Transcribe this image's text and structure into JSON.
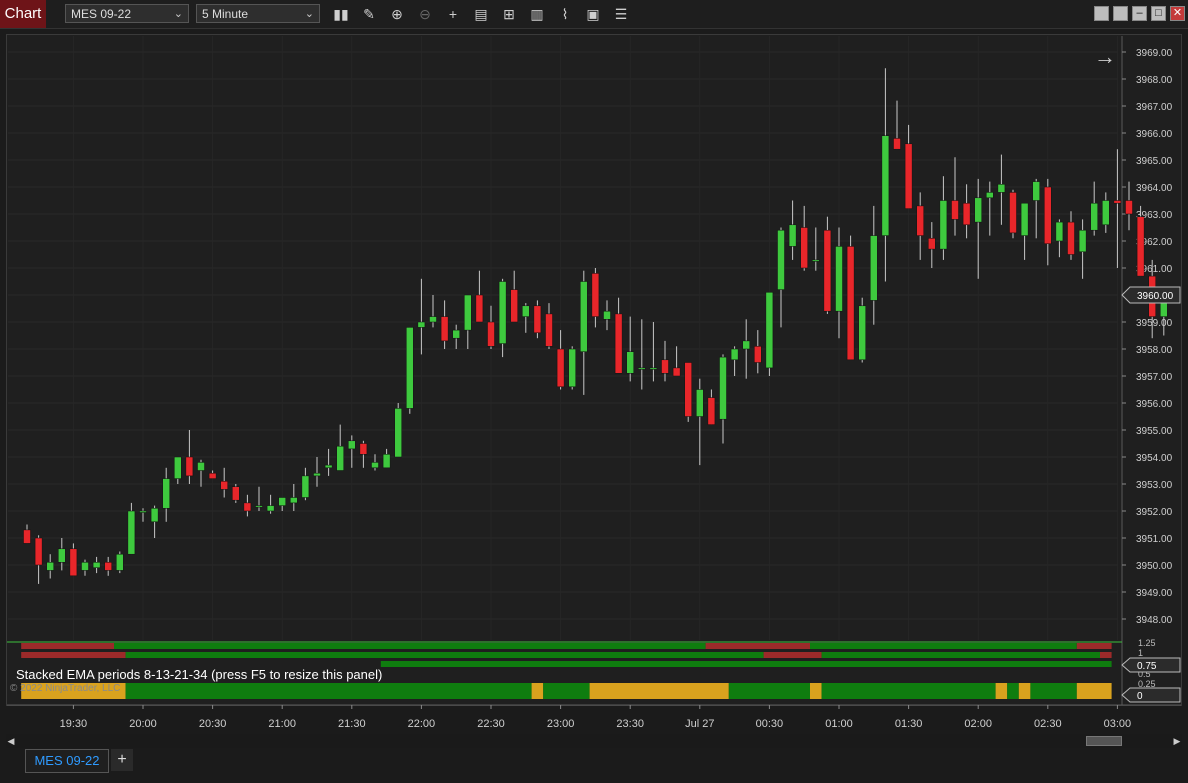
{
  "app": {
    "title": "Chart"
  },
  "toolbar": {
    "instrument": "MES 09-22",
    "interval": "5 Minute",
    "icons": [
      "bars-type-icon",
      "pencil-draw-icon",
      "zoom-in-icon",
      "zoom-out-icon",
      "crosshair-icon",
      "data-box-icon",
      "templates-icon",
      "strategies-icon",
      "indicators-icon",
      "properties-icon",
      "list-icon"
    ]
  },
  "window_controls": [
    "restore-icon",
    "restore-icon",
    "minimize-icon",
    "maximize-icon",
    "close-icon"
  ],
  "price_axis": {
    "labels": [
      "3969.00",
      "3968.00",
      "3967.00",
      "3966.00",
      "3965.00",
      "3964.00",
      "3963.00",
      "3962.00",
      "3961.00",
      "3960.00",
      "3959.00",
      "3958.00",
      "3957.00",
      "3956.00",
      "3955.00",
      "3954.00",
      "3953.00",
      "3952.00",
      "3951.00",
      "3950.00",
      "3949.00",
      "3948.00"
    ],
    "current_price": "3960.00"
  },
  "indicator_axis": {
    "labels": [
      "1.25",
      "1",
      "0.75",
      "0.5",
      "0.25",
      "0"
    ],
    "current_value": "0.75",
    "zero_label": "0"
  },
  "time_axis": {
    "labels": [
      "19:30",
      "20:00",
      "20:30",
      "21:00",
      "21:30",
      "22:00",
      "22:30",
      "23:00",
      "23:30",
      "Jul 27",
      "00:30",
      "01:00",
      "01:30",
      "02:00",
      "02:30",
      "03:00"
    ]
  },
  "indicator_panel": {
    "title": "Stacked EMA periods 8-13-21-34 (press F5 to resize this panel)"
  },
  "copyright": "© 2022 NinjaTrader, LLC",
  "tabs": [
    {
      "label": "MES 09-22"
    }
  ],
  "add_tab_label": "+",
  "colors": {
    "up": "#3ec93e",
    "down": "#e8262a",
    "gold": "#d9a21e",
    "green_bar": "#0f7d0f",
    "red_bar": "#9c2a2a",
    "background": "#1f1f1f"
  },
  "chart_data": {
    "type": "candlestick",
    "instrument": "MES 09-22",
    "interval": "5 Minute",
    "ylim": [
      3947.5,
      3969.5
    ],
    "candles": [
      [
        3951.3,
        3951.5,
        3950.8,
        3950.8
      ],
      [
        3951.0,
        3951.1,
        3949.3,
        3950.0
      ],
      [
        3949.8,
        3950.4,
        3949.5,
        3950.1
      ],
      [
        3950.1,
        3951.0,
        3949.8,
        3950.6
      ],
      [
        3950.6,
        3950.8,
        3949.6,
        3949.6
      ],
      [
        3949.8,
        3950.2,
        3949.6,
        3950.1
      ],
      [
        3949.9,
        3950.3,
        3949.7,
        3950.1
      ],
      [
        3950.1,
        3950.3,
        3949.6,
        3949.8
      ],
      [
        3949.8,
        3950.5,
        3949.7,
        3950.4
      ],
      [
        3950.4,
        3952.3,
        3950.4,
        3952.0
      ],
      [
        3952.0,
        3952.1,
        3951.6,
        3952.0
      ],
      [
        3951.6,
        3952.2,
        3951.0,
        3952.1
      ],
      [
        3952.1,
        3953.6,
        3951.6,
        3953.2
      ],
      [
        3953.2,
        3954.0,
        3953.0,
        3954.0
      ],
      [
        3954.0,
        3955.0,
        3953.0,
        3953.3
      ],
      [
        3953.5,
        3953.9,
        3952.9,
        3953.8
      ],
      [
        3953.4,
        3953.5,
        3953.2,
        3953.2
      ],
      [
        3953.1,
        3953.6,
        3952.5,
        3952.8
      ],
      [
        3952.9,
        3953.0,
        3952.3,
        3952.4
      ],
      [
        3952.3,
        3952.6,
        3951.8,
        3952.0
      ],
      [
        3952.2,
        3952.9,
        3952.0,
        3952.2
      ],
      [
        3952.0,
        3952.6,
        3951.9,
        3952.2
      ],
      [
        3952.2,
        3952.5,
        3952.0,
        3952.5
      ],
      [
        3952.3,
        3953.0,
        3952.0,
        3952.5
      ],
      [
        3952.5,
        3953.6,
        3952.4,
        3953.3
      ],
      [
        3953.3,
        3954.0,
        3952.9,
        3953.4
      ],
      [
        3953.6,
        3954.3,
        3953.3,
        3953.7
      ],
      [
        3953.5,
        3955.2,
        3953.5,
        3954.4
      ],
      [
        3954.3,
        3954.8,
        3953.6,
        3954.6
      ],
      [
        3954.5,
        3954.6,
        3953.6,
        3954.1
      ],
      [
        3953.6,
        3954.1,
        3953.5,
        3953.8
      ],
      [
        3953.6,
        3954.3,
        3953.6,
        3954.1
      ],
      [
        3954.0,
        3956.0,
        3954.0,
        3955.8
      ],
      [
        3955.8,
        3958.8,
        3955.6,
        3958.8
      ],
      [
        3958.8,
        3960.6,
        3957.8,
        3959.0
      ],
      [
        3959.0,
        3960.0,
        3958.8,
        3959.2
      ],
      [
        3959.2,
        3959.8,
        3958.0,
        3958.3
      ],
      [
        3958.4,
        3958.9,
        3958.0,
        3958.7
      ],
      [
        3958.7,
        3960.0,
        3958.0,
        3960.0
      ],
      [
        3960.0,
        3960.9,
        3959.3,
        3959.0
      ],
      [
        3959.0,
        3959.6,
        3958.0,
        3958.1
      ],
      [
        3958.2,
        3960.6,
        3957.7,
        3960.5
      ],
      [
        3960.2,
        3960.9,
        3959.0,
        3959.0
      ],
      [
        3959.2,
        3959.7,
        3958.6,
        3959.6
      ],
      [
        3959.6,
        3959.8,
        3958.4,
        3958.6
      ],
      [
        3959.3,
        3959.7,
        3958.0,
        3958.1
      ],
      [
        3958.0,
        3958.7,
        3956.5,
        3956.6
      ],
      [
        3956.6,
        3958.1,
        3956.5,
        3958.0
      ],
      [
        3957.9,
        3960.9,
        3956.3,
        3960.5
      ],
      [
        3960.8,
        3961.0,
        3958.8,
        3959.2
      ],
      [
        3959.1,
        3959.8,
        3958.7,
        3959.4
      ],
      [
        3959.3,
        3959.9,
        3957.6,
        3957.1
      ],
      [
        3957.1,
        3959.2,
        3956.8,
        3957.9
      ],
      [
        3957.3,
        3959.1,
        3956.5,
        3957.3
      ],
      [
        3957.3,
        3959.0,
        3956.8,
        3957.3
      ],
      [
        3957.6,
        3958.3,
        3956.8,
        3957.1
      ],
      [
        3957.3,
        3958.1,
        3957.0,
        3957.0
      ],
      [
        3957.5,
        3957.5,
        3955.3,
        3955.5
      ],
      [
        3955.5,
        3956.9,
        3953.7,
        3956.5
      ],
      [
        3956.2,
        3956.5,
        3955.2,
        3955.2
      ],
      [
        3955.4,
        3957.8,
        3954.5,
        3957.7
      ],
      [
        3957.6,
        3958.1,
        3957.0,
        3958.0
      ],
      [
        3958.0,
        3959.1,
        3956.9,
        3958.3
      ],
      [
        3958.1,
        3958.7,
        3957.1,
        3957.5
      ],
      [
        3957.3,
        3960.1,
        3957.0,
        3960.1
      ],
      [
        3960.2,
        3962.5,
        3958.8,
        3962.4
      ],
      [
        3961.8,
        3963.5,
        3961.3,
        3962.6
      ],
      [
        3962.5,
        3963.3,
        3960.9,
        3961.0
      ],
      [
        3961.3,
        3962.5,
        3960.9,
        3961.3
      ],
      [
        3962.4,
        3962.9,
        3959.3,
        3959.4
      ],
      [
        3959.4,
        3962.5,
        3958.4,
        3961.8
      ],
      [
        3961.8,
        3962.2,
        3957.6,
        3957.6
      ],
      [
        3957.6,
        3959.9,
        3957.5,
        3959.6
      ],
      [
        3959.8,
        3963.3,
        3958.9,
        3962.2
      ],
      [
        3962.2,
        3968.4,
        3960.5,
        3965.9
      ],
      [
        3965.8,
        3967.2,
        3965.4,
        3965.4
      ],
      [
        3965.6,
        3966.3,
        3963.2,
        3963.2
      ],
      [
        3963.3,
        3963.8,
        3961.3,
        3962.2
      ],
      [
        3962.1,
        3962.7,
        3961.0,
        3961.7
      ],
      [
        3961.7,
        3964.4,
        3961.3,
        3963.5
      ],
      [
        3963.5,
        3965.1,
        3962.2,
        3962.8
      ],
      [
        3963.4,
        3964.1,
        3962.1,
        3962.6
      ],
      [
        3962.7,
        3964.3,
        3960.6,
        3963.6
      ],
      [
        3963.6,
        3964.2,
        3962.2,
        3963.8
      ],
      [
        3963.8,
        3965.2,
        3962.6,
        3964.1
      ],
      [
        3963.8,
        3963.9,
        3962.1,
        3962.3
      ],
      [
        3962.2,
        3962.6,
        3961.3,
        3963.4
      ],
      [
        3963.5,
        3964.3,
        3962.1,
        3964.2
      ],
      [
        3964.0,
        3964.3,
        3961.1,
        3961.9
      ],
      [
        3962.0,
        3962.8,
        3961.4,
        3962.7
      ],
      [
        3962.7,
        3963.1,
        3961.3,
        3961.5
      ],
      [
        3961.6,
        3962.8,
        3960.6,
        3962.4
      ],
      [
        3962.4,
        3964.2,
        3962.2,
        3963.4
      ],
      [
        3962.6,
        3963.8,
        3962.3,
        3963.5
      ],
      [
        3963.5,
        3965.4,
        3961.0,
        3963.4
      ],
      [
        3963.5,
        3964.2,
        3962.4,
        3963.0
      ],
      [
        3962.9,
        3963.3,
        3960.7,
        3960.7
      ],
      [
        3960.7,
        3961.3,
        3958.4,
        3959.2
      ],
      [
        3959.2,
        3960.2,
        3958.5,
        3959.9
      ]
    ],
    "candle_format": [
      "open",
      "high",
      "low",
      "close"
    ],
    "x_tick_labels": [
      "19:30",
      "20:00",
      "20:30",
      "21:00",
      "21:30",
      "22:00",
      "22:30",
      "23:00",
      "23:30",
      "Jul 27",
      "00:30",
      "01:00",
      "01:30",
      "02:00",
      "02:30",
      "03:00"
    ],
    "current_price": 3960.0,
    "indicator": {
      "name": "Stacked EMA periods 8-13-21-34",
      "ylim": [
        0,
        1.25
      ],
      "rows": [
        {
          "level": 1.0,
          "segments": [
            [
              "red",
              0,
              8
            ],
            [
              "green",
              8,
              59
            ],
            [
              "red",
              59,
              68
            ],
            [
              "green",
              68,
              91
            ],
            [
              "red",
              91,
              94
            ]
          ]
        },
        {
          "level": 0.75,
          "segments": [
            [
              "red",
              0,
              9
            ],
            [
              "green",
              9,
              64
            ],
            [
              "red",
              64,
              69
            ],
            [
              "green",
              69,
              93
            ],
            [
              "red",
              93,
              94
            ]
          ]
        },
        {
          "level": 0.5,
          "segments": [
            [
              "green",
              31,
              94
            ]
          ]
        },
        {
          "level": 0.0,
          "segments": [
            [
              "gold",
              0,
              9
            ],
            [
              "green",
              9,
              44
            ],
            [
              "gold",
              44,
              45
            ],
            [
              "green",
              45,
              49
            ],
            [
              "gold",
              49,
              61
            ],
            [
              "green",
              61,
              68
            ],
            [
              "gold",
              68,
              69
            ],
            [
              "green",
              69,
              84
            ],
            [
              "gold",
              84,
              85
            ],
            [
              "green",
              85,
              86
            ],
            [
              "gold",
              86,
              87
            ],
            [
              "green",
              87,
              91
            ],
            [
              "gold",
              91,
              94
            ]
          ]
        }
      ]
    }
  }
}
